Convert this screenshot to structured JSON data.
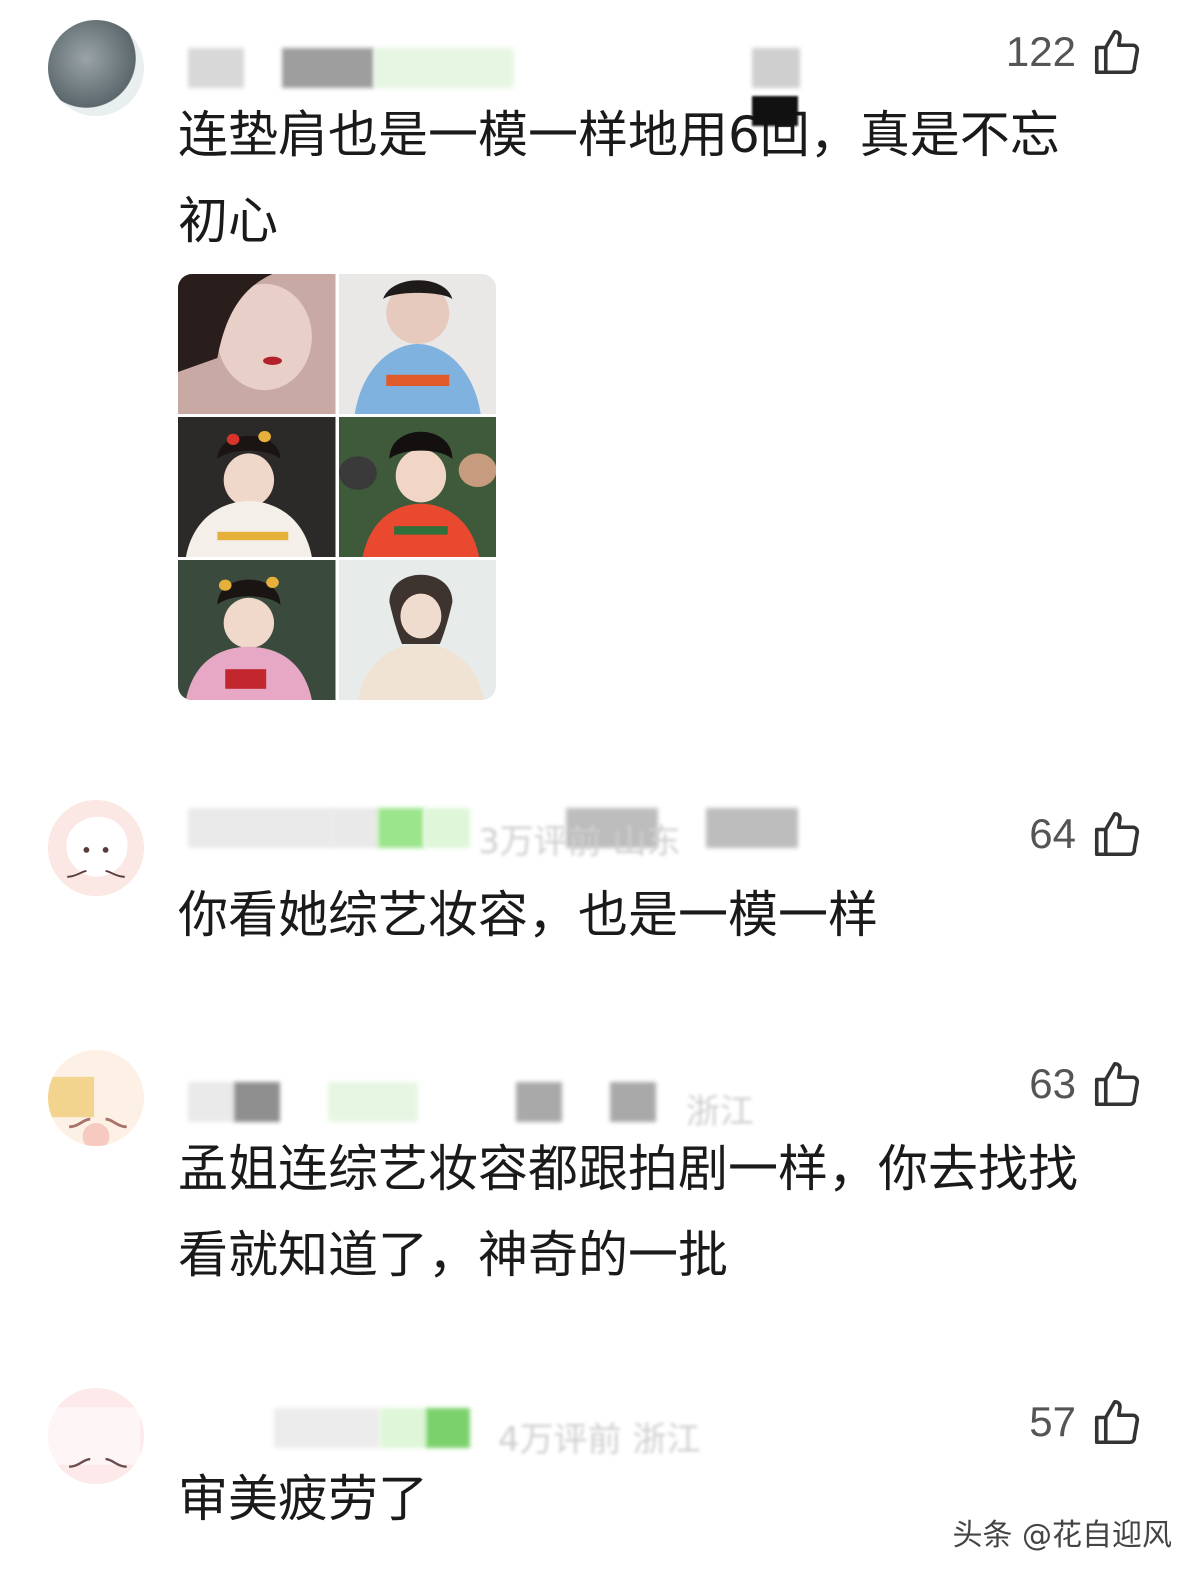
{
  "comments": [
    {
      "likes": "122",
      "text_lines": [
        "连垫肩也是一模一样地用6回，真是不忘",
        "初心"
      ],
      "has_image_grid": true
    },
    {
      "likes": "64",
      "meta": "3万评前   山东",
      "text_lines": [
        "你看她综艺妆容，也是一模一样"
      ]
    },
    {
      "likes": "63",
      "meta": "浙江",
      "text_lines": [
        "孟姐连综艺妆容都跟拍剧一样，你去找找",
        "看就知道了，神奇的一批"
      ]
    },
    {
      "likes": "57",
      "meta": "4万评前  浙江",
      "text_lines": [
        "审美疲劳了"
      ]
    }
  ],
  "icons": {
    "like": "thumbs-up-icon"
  },
  "watermark": "头条 @花自迎风",
  "colors": {
    "text": "#1a1a1a",
    "like_count": "#555555",
    "blur_green": "#9be58c",
    "blur_gray": "#bdbdbd"
  }
}
